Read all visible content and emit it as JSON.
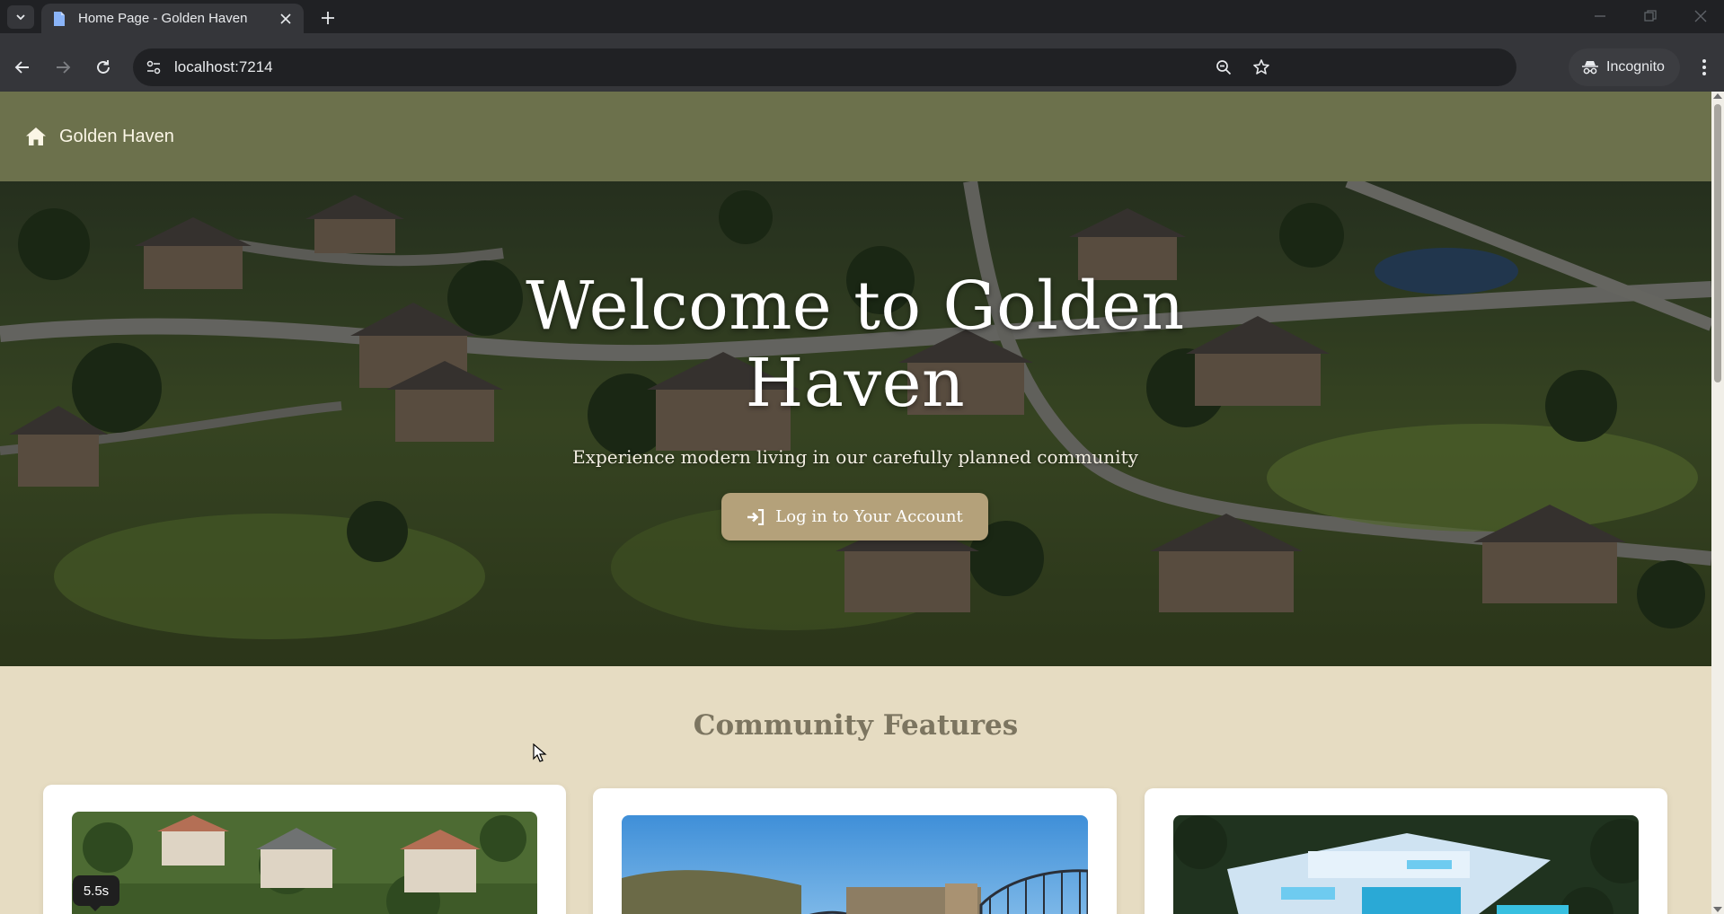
{
  "browser": {
    "tab_title": "Home Page - Golden Haven",
    "url": "localhost:7214",
    "profile_label": "Incognito"
  },
  "site": {
    "brand": "Golden Haven",
    "hero": {
      "title": "Welcome to Golden Haven",
      "subtitle": "Experience modern living in our carefully planned community",
      "cta_label": "Log in to Your Account"
    },
    "features": {
      "heading": "Community Features"
    }
  },
  "overlay": {
    "timer_label": "5.5s"
  },
  "colors": {
    "nav_bg": "#6c714c",
    "accent_button": "#b4a17a",
    "page_bg": "#e6dcc2",
    "heading": "#7c7560"
  }
}
